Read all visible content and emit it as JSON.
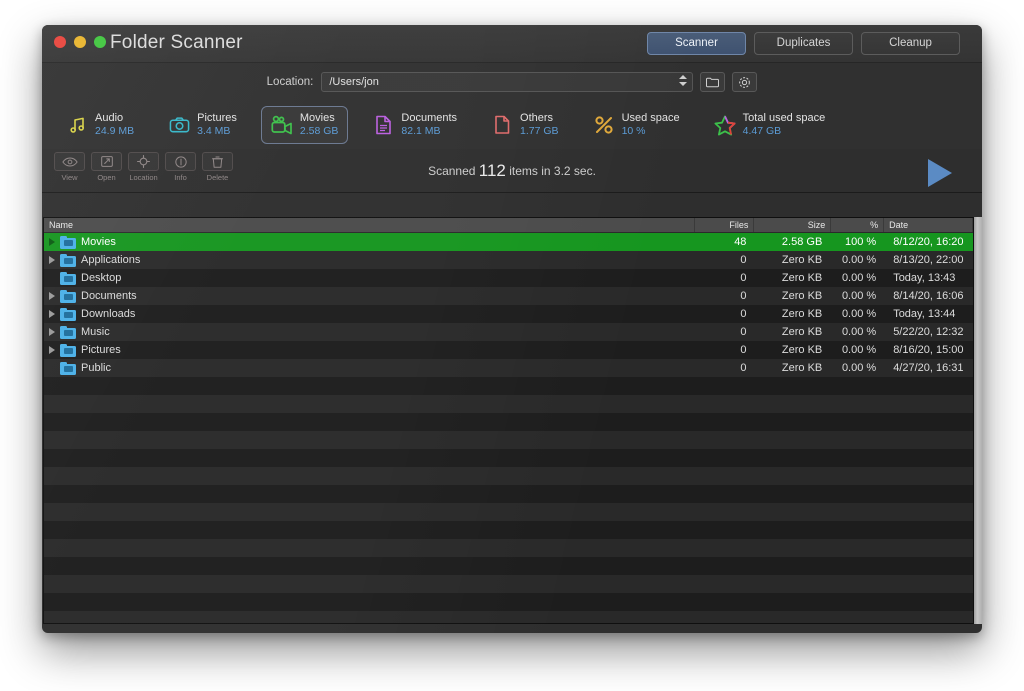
{
  "window": {
    "title": "Folder Scanner",
    "traffic_lights": [
      "close-red",
      "minimize-yellow",
      "zoom-green"
    ]
  },
  "segments": [
    {
      "label": "Scanner",
      "active": true
    },
    {
      "label": "Duplicates",
      "active": false
    },
    {
      "label": "Cleanup",
      "active": false
    }
  ],
  "location": {
    "label": "Location:",
    "value": "/Users/jon",
    "placeholder": "/Users/jon",
    "browse_icon": "folder-icon",
    "settings_icon": "gear-icon"
  },
  "categories": [
    {
      "name": "Audio",
      "value": "24.9 MB",
      "icon": "music-note-icon",
      "color": "#d8d246",
      "selected": false
    },
    {
      "name": "Pictures",
      "value": "3.4 MB",
      "icon": "camera-icon",
      "color": "#35b7c9",
      "selected": false
    },
    {
      "name": "Movies",
      "value": "2.58 GB",
      "icon": "video-camera-icon",
      "color": "#3cc04a",
      "selected": true
    },
    {
      "name": "Documents",
      "value": "82.1 MB",
      "icon": "document-icon",
      "color": "#bb5fe0",
      "selected": false
    },
    {
      "name": "Others",
      "value": "1.77 GB",
      "icon": "file-outline-icon",
      "color": "#e06b6b",
      "selected": false
    },
    {
      "name": "Used space",
      "value": "10 %",
      "icon": "percent-icon",
      "color": "#e0a83a",
      "selected": false
    },
    {
      "name": "Total used space",
      "value": "4.47 GB",
      "icon": "star-icon",
      "color": "#3cc04a",
      "selected": false
    }
  ],
  "toolbar": {
    "tools": [
      {
        "label": "View",
        "icon": "eye-icon"
      },
      {
        "label": "Open",
        "icon": "open-window-icon"
      },
      {
        "label": "Location",
        "icon": "target-icon"
      },
      {
        "label": "Info",
        "icon": "info-circle-icon"
      },
      {
        "label": "Delete",
        "icon": "trash-icon"
      }
    ],
    "status_prefix": "Scanned",
    "status_count": "112",
    "status_suffix": "items in 3.2 sec.",
    "play_icon": "play-triangle-icon"
  },
  "table": {
    "columns": [
      "Name",
      "Files",
      "Size",
      "%",
      "Date"
    ],
    "rows": [
      {
        "name": "Movies",
        "files": "48",
        "size": "2.58 GB",
        "pct": "100 %",
        "date": "8/12/20, 16:20",
        "expandable": true,
        "selected": true
      },
      {
        "name": "Applications",
        "files": "0",
        "size": "Zero KB",
        "pct": "0.00 %",
        "date": "8/13/20, 22:00",
        "expandable": true,
        "selected": false
      },
      {
        "name": "Desktop",
        "files": "0",
        "size": "Zero KB",
        "pct": "0.00 %",
        "date": "Today, 13:43",
        "expandable": false,
        "selected": false
      },
      {
        "name": "Documents",
        "files": "0",
        "size": "Zero KB",
        "pct": "0.00 %",
        "date": "8/14/20, 16:06",
        "expandable": true,
        "selected": false
      },
      {
        "name": "Downloads",
        "files": "0",
        "size": "Zero KB",
        "pct": "0.00 %",
        "date": "Today, 13:44",
        "expandable": true,
        "selected": false
      },
      {
        "name": "Music",
        "files": "0",
        "size": "Zero KB",
        "pct": "0.00 %",
        "date": "5/22/20, 12:32",
        "expandable": true,
        "selected": false
      },
      {
        "name": "Pictures",
        "files": "0",
        "size": "Zero KB",
        "pct": "0.00 %",
        "date": "8/16/20, 15:00",
        "expandable": true,
        "selected": false
      },
      {
        "name": "Public",
        "files": "0",
        "size": "Zero KB",
        "pct": "0.00 %",
        "date": "4/27/20, 16:31",
        "expandable": false,
        "selected": false
      }
    ],
    "empty_row_count": 15
  },
  "colors": {
    "selection_green": "#16961f",
    "accent_blue": "#5b9bd5",
    "window_bg": "#2e2e2e",
    "table_bg": "#1d1d1d"
  }
}
